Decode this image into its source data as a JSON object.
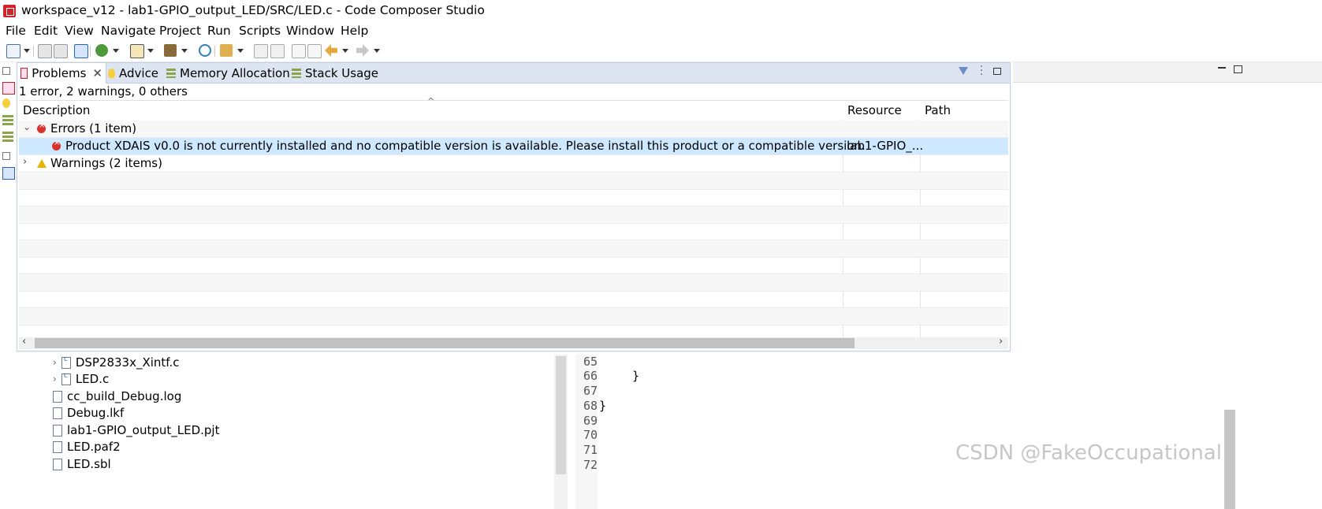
{
  "window": {
    "title": "workspace_v12 - lab1-GPIO_output_LED/SRC/LED.c - Code Composer Studio"
  },
  "menu": [
    "File",
    "Edit",
    "View",
    "Navigate",
    "Project",
    "Run",
    "Scripts",
    "Window",
    "Help"
  ],
  "problems_view": {
    "tabs": [
      {
        "label": "Problems",
        "icon": "problems-icon"
      },
      {
        "label": "Advice",
        "icon": "lightbulb-icon"
      },
      {
        "label": "Memory Allocation",
        "icon": "memory-bars-icon"
      },
      {
        "label": "Stack Usage",
        "icon": "stack-bars-icon"
      }
    ],
    "summary": "1 error, 2 warnings, 0 others",
    "columns": [
      "Description",
      "Resource",
      "Path"
    ],
    "errors_group": "Errors (1 item)",
    "error_row": {
      "description": "Product XDAIS v0.0 is not currently installed and no compatible version is available. Please install this product or a compatible version.",
      "resource": "lab1-GPIO_...",
      "path": ""
    },
    "warnings_group": "Warnings (2 items)"
  },
  "explorer": {
    "files": [
      {
        "name": "DSP2833x_Xintf.c",
        "type": "c",
        "expandable": true
      },
      {
        "name": "LED.c",
        "type": "c",
        "expandable": true
      },
      {
        "name": "cc_build_Debug.log",
        "type": "file",
        "expandable": false
      },
      {
        "name": "Debug.lkf",
        "type": "file",
        "expandable": false
      },
      {
        "name": "lab1-GPIO_output_LED.pjt",
        "type": "file",
        "expandable": false
      },
      {
        "name": "LED.paf2",
        "type": "file",
        "expandable": false
      },
      {
        "name": "LED.sbl",
        "type": "file",
        "expandable": false
      }
    ]
  },
  "editor": {
    "line_numbers": [
      "65",
      "66",
      "67",
      "68",
      "69",
      "70",
      "71",
      "72"
    ],
    "code_lines": {
      "66": "}",
      "68": "}"
    }
  },
  "watermark": "CSDN @FakeOccupational",
  "colors": {
    "selection": "#cde8ff",
    "tabbar": "#dde4f2",
    "error": "#d9322c",
    "warning": "#e8b400"
  }
}
